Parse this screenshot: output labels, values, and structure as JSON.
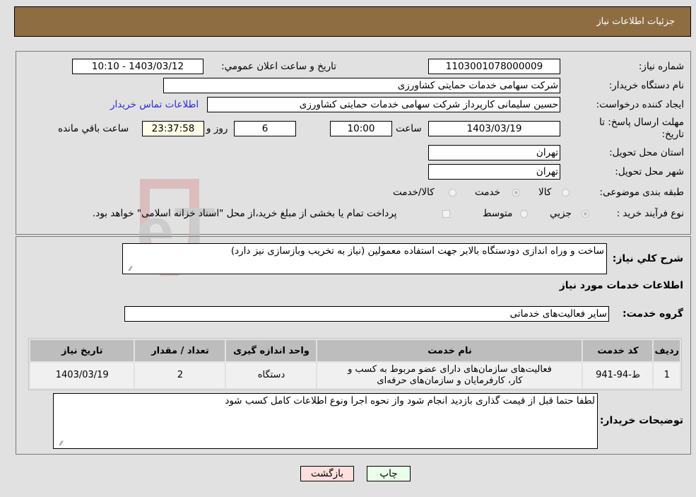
{
  "header": {
    "title": "جزئیات اطلاعات نیاز"
  },
  "form": {
    "need_number": {
      "label": "شماره نیاز:",
      "value": "1103001078000009"
    },
    "announce": {
      "label": "تاریخ و ساعت اعلان عمومي:",
      "value": "1403/03/12 - 10:10"
    },
    "buyer_org": {
      "label": "نام دستگاه خریدار:",
      "value": "شرکت سهامی خدمات حمایتی کشاورزی"
    },
    "creator": {
      "label": "ایجاد کننده درخواست:",
      "value": "حسین سلیمانی کارپرداز شرکت سهامی خدمات حمایتی کشاورزی",
      "contact_link": "اطلاعات تماس خریدار"
    },
    "deadline": {
      "label": "مهلت ارسال پاسخ: تا تاریخ:",
      "date": "1403/03/19",
      "time_label": "ساعت",
      "time": "10:00",
      "days": "6",
      "days_label": "روز و",
      "remaining": "23:37:58",
      "remaining_label": "ساعت باقي مانده"
    },
    "province": {
      "label": "استان محل تحویل:",
      "value": "تهران"
    },
    "city": {
      "label": "شهر محل تحویل:",
      "value": "تهران"
    },
    "category": {
      "label": "طبقه بندی موضوعی:",
      "options": [
        "کالا",
        "خدمت",
        "کالا/خدمت"
      ],
      "selected": "خدمت"
    },
    "process": {
      "label": "نوع فرآیند خرید :",
      "options": [
        "جزيي",
        "متوسط"
      ],
      "selected": "جزيي",
      "treasury_note": "پرداخت تمام یا بخشی از مبلغ خرید،از محل \"اسناد خزانه اسلامی\" خواهد بود."
    }
  },
  "details": {
    "summary_label": "شرح کلي نیاز:",
    "summary": "ساخت و وراه اندازی دودستگاه بالابر جهت استفاده معمولین (نیاز به تخریب وبازسازی نیز دارد)",
    "services_heading": "اطلاعات خدمات مورد نیاز",
    "service_group_label": "گروه خدمت:",
    "service_group": "سایر فعالیت‌های خدماتی",
    "table": {
      "headers": [
        "ردیف",
        "کد خدمت",
        "نام خدمت",
        "واحد اندازه گیری",
        "تعداد / مقدار",
        "تاریخ نیاز"
      ],
      "rows": [
        [
          "1",
          "ط-94-941",
          "فعالیت‌های سازمان‌های دارای عضو مربوط به کسب و کار، کارفرمایان و سازمان‌های حرفه‌ای",
          "دستگاه",
          "2",
          "1403/03/19"
        ]
      ]
    },
    "buyer_notes_label": "توضیحات خریدار:",
    "buyer_notes": "لطفا حتما قبل از قیمت گذاری بازدید انجام شود واز نحوه اجرا ونوع اطلاعات کامل کسب شود"
  },
  "buttons": {
    "print": "چاپ",
    "back": "بازگشت"
  },
  "watermark": {
    "text": "AriaTender.neT"
  },
  "colors": {
    "header": "#8e6d42",
    "link": "#2b2bd4",
    "print_bg": "#eaffea",
    "back_bg": "#ffdede"
  }
}
